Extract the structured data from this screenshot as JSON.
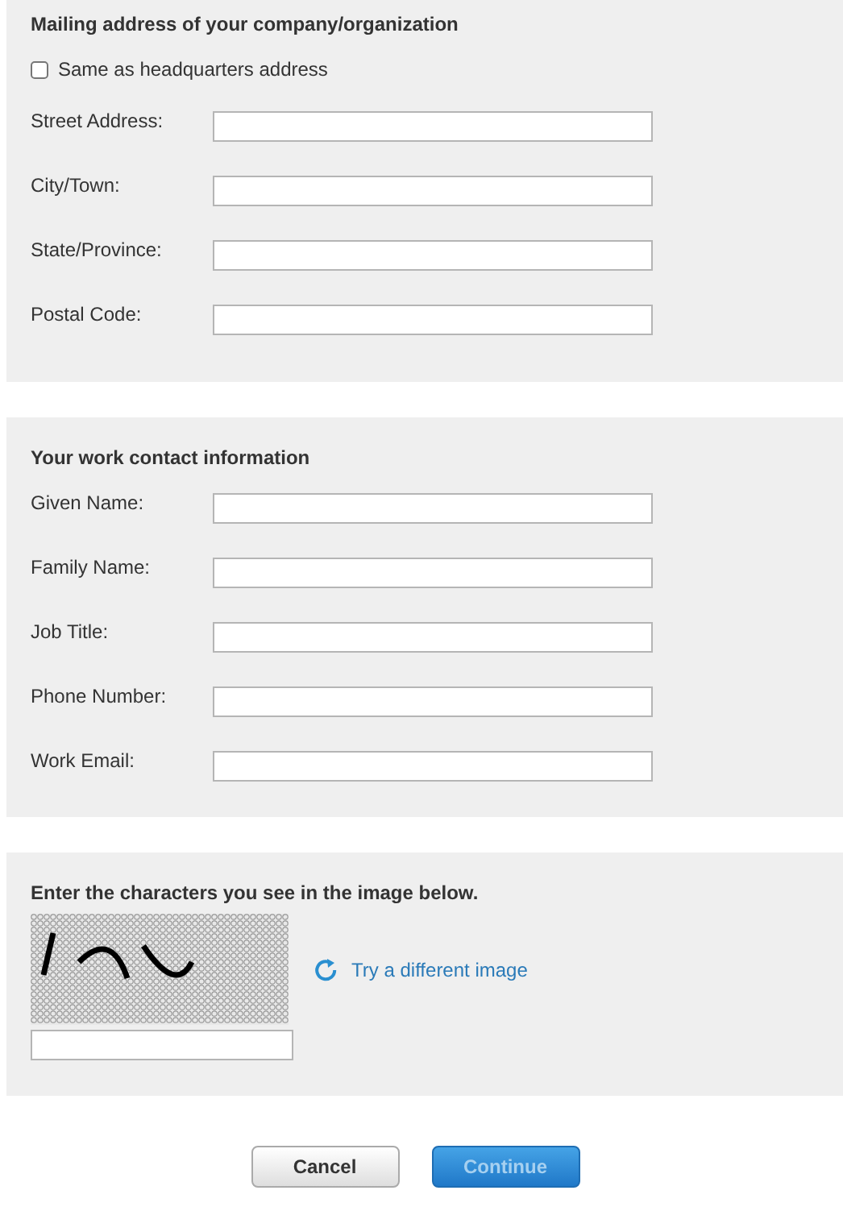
{
  "mailing_section": {
    "title": "Mailing address of your company/organization",
    "same_as_hq": {
      "label": "Same as headquarters address",
      "checked": false
    },
    "fields": [
      {
        "label": "Street Address:"
      },
      {
        "label": "City/Town:"
      },
      {
        "label": "State/Province:"
      },
      {
        "label": "Postal Code:"
      }
    ]
  },
  "contact_section": {
    "title": "Your work contact information",
    "fields": [
      {
        "label": "Given Name:"
      },
      {
        "label": "Family Name:"
      },
      {
        "label": "Job Title:"
      },
      {
        "label": "Phone Number:"
      },
      {
        "label": "Work Email:"
      }
    ]
  },
  "captcha_section": {
    "title": "Enter the characters you see in the image below.",
    "refresh_link": "Try a different image"
  },
  "buttons": [
    {
      "label": "Cancel",
      "kind": "secondary",
      "disabled": false
    },
    {
      "label": "Continue",
      "kind": "primary",
      "disabled": true
    }
  ]
}
